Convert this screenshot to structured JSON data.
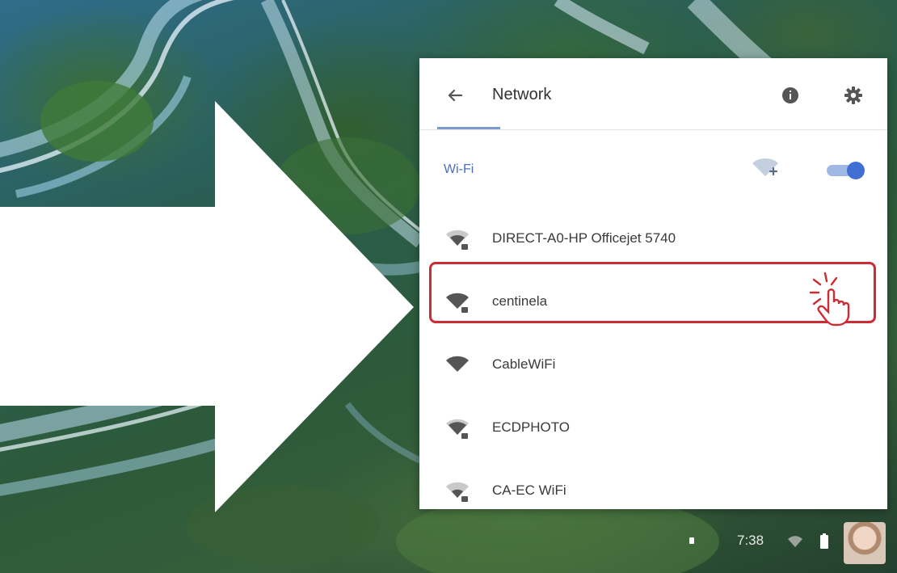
{
  "panel": {
    "title": "Network",
    "back_icon": "arrow-left-icon",
    "info_icon": "info-icon",
    "settings_icon": "gear-icon"
  },
  "wifi": {
    "label": "Wi-Fi",
    "add_network_icon": "wifi-add-icon",
    "enabled": true
  },
  "networks": [
    {
      "name": "DIRECT-A0-HP Officejet 5740",
      "secured": true
    },
    {
      "name": "centinela",
      "secured": true,
      "highlighted": true
    },
    {
      "name": "CableWiFi",
      "secured": false
    },
    {
      "name": "ECDPHOTO",
      "secured": true
    },
    {
      "name": "CA-EC WiFi",
      "secured": true
    }
  ],
  "shelf": {
    "time": "7:38",
    "wifi_icon": "wifi-icon",
    "battery_icon": "battery-icon"
  },
  "colors": {
    "accent": "#3f6fd3",
    "highlight": "#cc2c34",
    "wifi_label": "#4a6fc0"
  }
}
